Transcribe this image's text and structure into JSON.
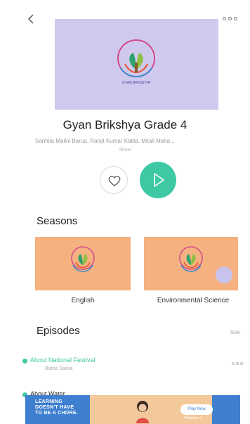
{
  "show": {
    "title": "Gyan Brikshya Grade 4",
    "authors": "Sanhita Malini Barua, Ranjit Kumar Kalita, Mitali Maha...",
    "kind": "Show",
    "cover_color": "#cfc9ee",
    "cover_logo_text": "GYAN BRIKSHYA"
  },
  "actions": {
    "like_icon": "heart-icon",
    "play_icon": "play-icon",
    "accent": "#3ec8a4"
  },
  "seasons": {
    "title": "Seasons",
    "items": [
      {
        "label": "English"
      },
      {
        "label": "Environmental Science"
      }
    ]
  },
  "episodes": {
    "title": "Episodes",
    "see_all": "See",
    "items": [
      {
        "title": "About National Festival",
        "author": "Barsa Saikia",
        "active": true
      },
      {
        "title": "About Water",
        "author": "",
        "active": false
      }
    ]
  },
  "ad": {
    "headline": [
      "LEARNING",
      "DOESN'T HAVE",
      "TO BE A CHORE."
    ],
    "cta": "Play Now",
    "brand": "Whitehat Jr"
  }
}
